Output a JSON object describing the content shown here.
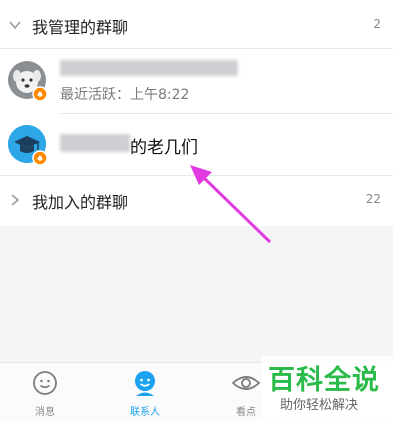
{
  "managed_group": {
    "title": "我管理的群聊",
    "count": "2",
    "items": [
      {
        "subtitle": "最近活跃：上午8:22"
      },
      {
        "name_suffix": "的老几们"
      }
    ]
  },
  "joined_group": {
    "title": "我加入的群聊",
    "count": "22"
  },
  "tabbar": {
    "tabs": [
      {
        "label": "消息"
      },
      {
        "label": "联系人"
      },
      {
        "label": "看点"
      }
    ]
  },
  "watermark": {
    "title": "百科全说",
    "subtitle": "助你轻松解决"
  },
  "colors": {
    "accent": "#1aa1f0",
    "arrow": "#e13ae0",
    "watermark": "#2bbb4a"
  }
}
